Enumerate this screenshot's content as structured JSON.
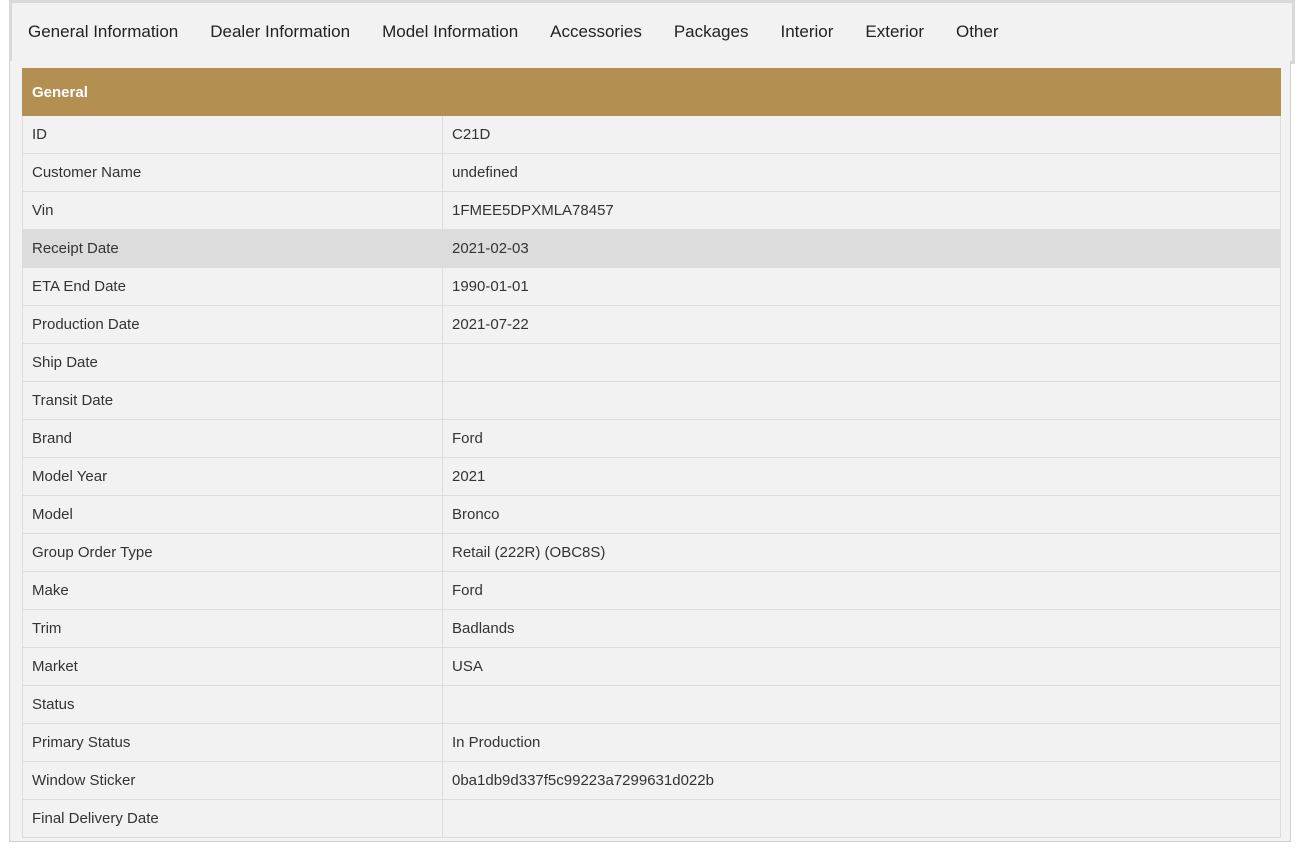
{
  "tabs": [
    {
      "label": "General Information"
    },
    {
      "label": "Dealer Information"
    },
    {
      "label": "Model Information"
    },
    {
      "label": "Accessories"
    },
    {
      "label": "Packages"
    },
    {
      "label": "Interior"
    },
    {
      "label": "Exterior"
    },
    {
      "label": "Other"
    }
  ],
  "table": {
    "header": {
      "field": "General",
      "value": ""
    },
    "header_color": "#b38f52",
    "highlight_color": "#dcdcdc",
    "rows": [
      {
        "field": "ID",
        "value": "C21D"
      },
      {
        "field": "Customer Name",
        "value": "undefined"
      },
      {
        "field": "Vin",
        "value": "1FMEE5DPXMLA78457"
      },
      {
        "field": "Receipt Date",
        "value": "2021-02-03"
      },
      {
        "field": "ETA End Date",
        "value": "1990-01-01"
      },
      {
        "field": "Production Date",
        "value": "2021-07-22"
      },
      {
        "field": "Ship Date",
        "value": ""
      },
      {
        "field": "Transit Date",
        "value": ""
      },
      {
        "field": "Brand",
        "value": "Ford"
      },
      {
        "field": "Model Year",
        "value": "2021"
      },
      {
        "field": "Model",
        "value": "Bronco"
      },
      {
        "field": "Group Order Type",
        "value": "Retail (222R) (OBC8S)"
      },
      {
        "field": "Make",
        "value": "Ford"
      },
      {
        "field": "Trim",
        "value": "Badlands"
      },
      {
        "field": "Market",
        "value": "USA"
      },
      {
        "field": "Status",
        "value": ""
      },
      {
        "field": "Primary Status",
        "value": "In Production"
      },
      {
        "field": "Window Sticker",
        "value": "0ba1db9d337f5c99223a7299631d022b"
      },
      {
        "field": "Final Delivery Date",
        "value": ""
      }
    ]
  }
}
